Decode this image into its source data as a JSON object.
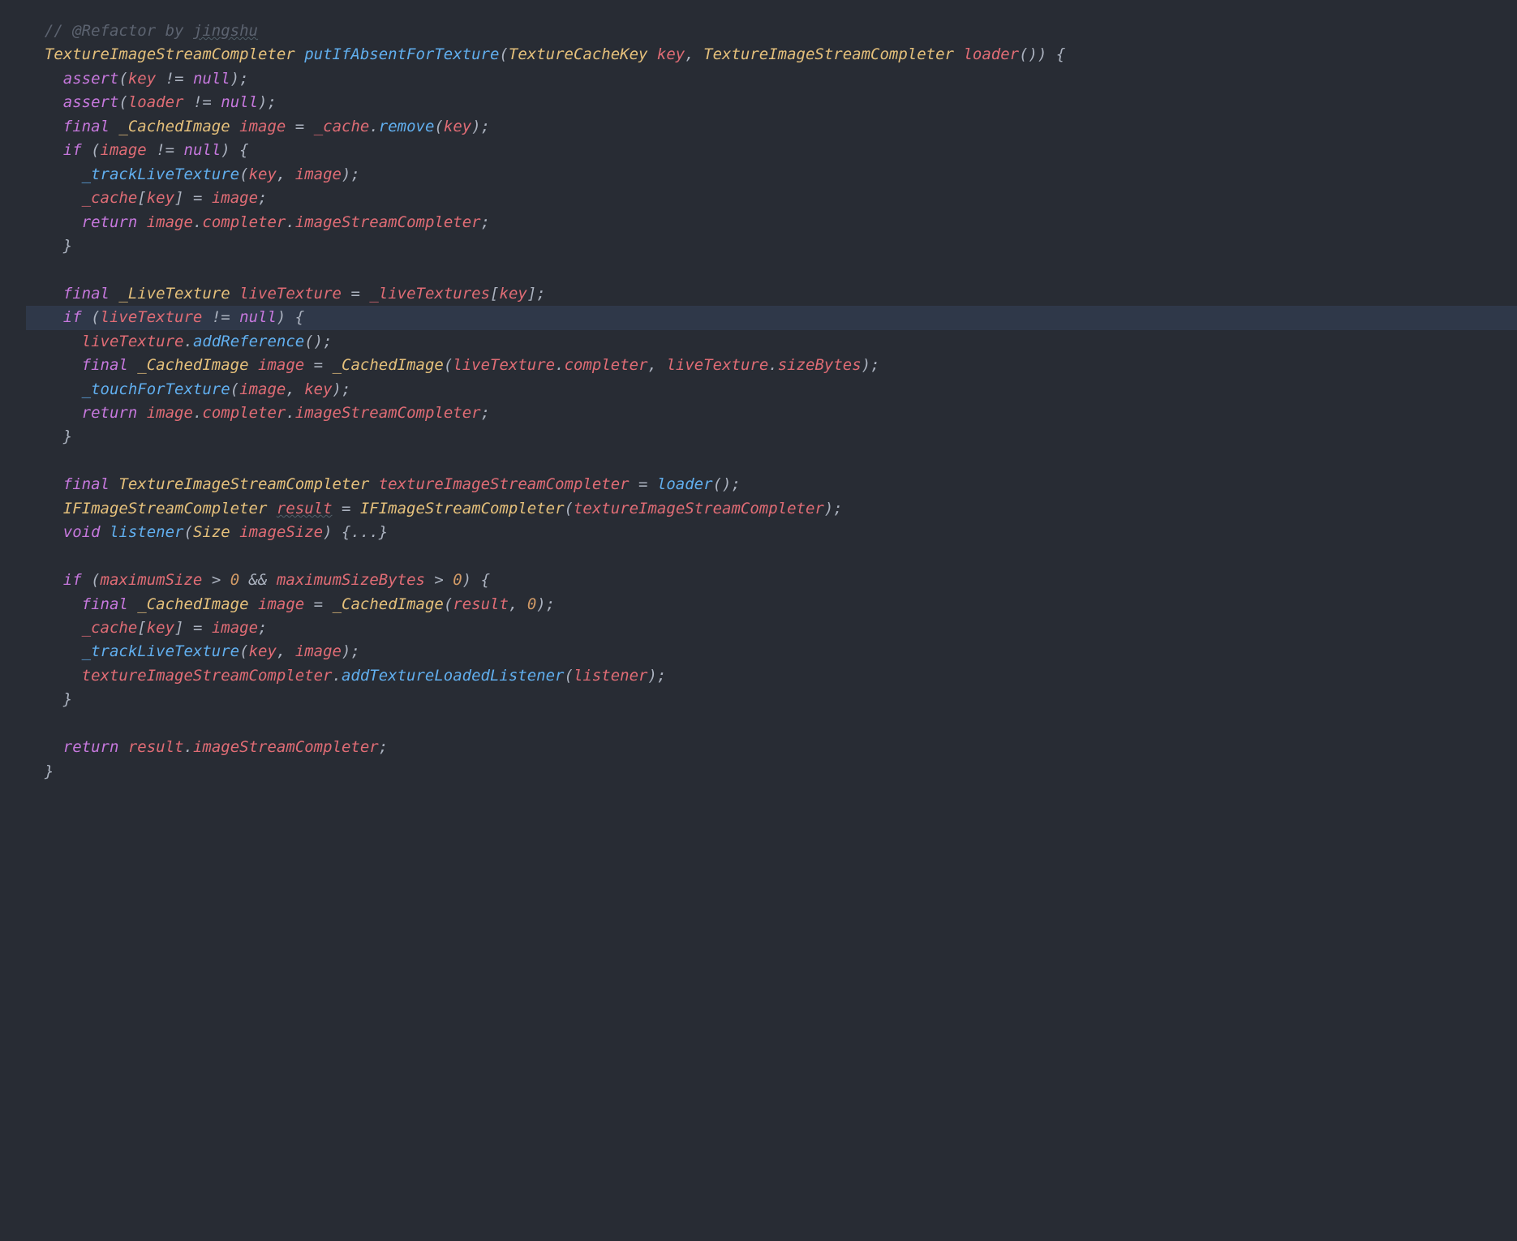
{
  "tokens": [
    [
      {
        "c": "  ",
        "cls": "plain"
      },
      {
        "c": "// @Refactor by ",
        "cls": "cmt"
      },
      {
        "c": "jingshu",
        "cls": "cmt under"
      }
    ],
    [
      {
        "c": "  ",
        "cls": "plain"
      },
      {
        "c": "TextureImageStreamCompleter",
        "cls": "type"
      },
      {
        "c": " ",
        "cls": "plain"
      },
      {
        "c": "putIfAbsentForTexture",
        "cls": "fn"
      },
      {
        "c": "(",
        "cls": "punc"
      },
      {
        "c": "TextureCacheKey",
        "cls": "type"
      },
      {
        "c": " key",
        "cls": "ident"
      },
      {
        "c": ", ",
        "cls": "punc"
      },
      {
        "c": "TextureImageStreamCompleter",
        "cls": "type"
      },
      {
        "c": " ",
        "cls": "plain"
      },
      {
        "c": "loader",
        "cls": "ident"
      },
      {
        "c": "()) {",
        "cls": "punc"
      }
    ],
    [
      {
        "c": "    ",
        "cls": "plain"
      },
      {
        "c": "assert",
        "cls": "kw"
      },
      {
        "c": "(",
        "cls": "punc"
      },
      {
        "c": "key",
        "cls": "ident"
      },
      {
        "c": " != ",
        "cls": "punc"
      },
      {
        "c": "null",
        "cls": "kw"
      },
      {
        "c": ");",
        "cls": "punc"
      }
    ],
    [
      {
        "c": "    ",
        "cls": "plain"
      },
      {
        "c": "assert",
        "cls": "kw"
      },
      {
        "c": "(",
        "cls": "punc"
      },
      {
        "c": "loader",
        "cls": "ident"
      },
      {
        "c": " != ",
        "cls": "punc"
      },
      {
        "c": "null",
        "cls": "kw"
      },
      {
        "c": ");",
        "cls": "punc"
      }
    ],
    [
      {
        "c": "    ",
        "cls": "plain"
      },
      {
        "c": "final",
        "cls": "kw"
      },
      {
        "c": " ",
        "cls": "plain"
      },
      {
        "c": "_CachedImage",
        "cls": "type"
      },
      {
        "c": " ",
        "cls": "plain"
      },
      {
        "c": "image",
        "cls": "ident"
      },
      {
        "c": " = ",
        "cls": "punc"
      },
      {
        "c": "_cache",
        "cls": "ident"
      },
      {
        "c": ".",
        "cls": "punc"
      },
      {
        "c": "remove",
        "cls": "fn"
      },
      {
        "c": "(",
        "cls": "punc"
      },
      {
        "c": "key",
        "cls": "ident"
      },
      {
        "c": ");",
        "cls": "punc"
      }
    ],
    [
      {
        "c": "    ",
        "cls": "plain"
      },
      {
        "c": "if",
        "cls": "kw"
      },
      {
        "c": " (",
        "cls": "punc"
      },
      {
        "c": "image",
        "cls": "ident"
      },
      {
        "c": " != ",
        "cls": "punc"
      },
      {
        "c": "null",
        "cls": "kw"
      },
      {
        "c": ") {",
        "cls": "punc"
      }
    ],
    [
      {
        "c": "      ",
        "cls": "plain"
      },
      {
        "c": "_trackLiveTexture",
        "cls": "fn"
      },
      {
        "c": "(",
        "cls": "punc"
      },
      {
        "c": "key",
        "cls": "ident"
      },
      {
        "c": ", ",
        "cls": "punc"
      },
      {
        "c": "image",
        "cls": "ident"
      },
      {
        "c": ");",
        "cls": "punc"
      }
    ],
    [
      {
        "c": "      ",
        "cls": "plain"
      },
      {
        "c": "_cache",
        "cls": "ident"
      },
      {
        "c": "[",
        "cls": "punc"
      },
      {
        "c": "key",
        "cls": "ident"
      },
      {
        "c": "] = ",
        "cls": "punc"
      },
      {
        "c": "image",
        "cls": "ident"
      },
      {
        "c": ";",
        "cls": "punc"
      }
    ],
    [
      {
        "c": "      ",
        "cls": "plain"
      },
      {
        "c": "return",
        "cls": "kw"
      },
      {
        "c": " ",
        "cls": "plain"
      },
      {
        "c": "image",
        "cls": "ident"
      },
      {
        "c": ".",
        "cls": "punc"
      },
      {
        "c": "completer",
        "cls": "ident"
      },
      {
        "c": ".",
        "cls": "punc"
      },
      {
        "c": "imageStreamCompleter",
        "cls": "ident"
      },
      {
        "c": ";",
        "cls": "punc"
      }
    ],
    [
      {
        "c": "    }",
        "cls": "punc"
      }
    ],
    [
      {
        "c": "",
        "cls": "plain"
      }
    ],
    [
      {
        "c": "    ",
        "cls": "plain"
      },
      {
        "c": "final",
        "cls": "kw"
      },
      {
        "c": " ",
        "cls": "plain"
      },
      {
        "c": "_LiveTexture",
        "cls": "type"
      },
      {
        "c": " ",
        "cls": "plain"
      },
      {
        "c": "liveTexture",
        "cls": "ident"
      },
      {
        "c": " = ",
        "cls": "punc"
      },
      {
        "c": "_liveTextures",
        "cls": "ident"
      },
      {
        "c": "[",
        "cls": "punc"
      },
      {
        "c": "key",
        "cls": "ident"
      },
      {
        "c": "];",
        "cls": "punc"
      }
    ],
    [
      {
        "c": "    ",
        "cls": "plain"
      },
      {
        "c": "if",
        "cls": "kw"
      },
      {
        "c": " (",
        "cls": "punc"
      },
      {
        "c": "liveTexture",
        "cls": "ident"
      },
      {
        "c": " != ",
        "cls": "punc"
      },
      {
        "c": "null",
        "cls": "kw"
      },
      {
        "c": ") {",
        "cls": "punc"
      }
    ],
    [
      {
        "c": "      ",
        "cls": "plain"
      },
      {
        "c": "liveTexture",
        "cls": "ident"
      },
      {
        "c": ".",
        "cls": "punc"
      },
      {
        "c": "addReference",
        "cls": "fn"
      },
      {
        "c": "();",
        "cls": "punc"
      }
    ],
    [
      {
        "c": "      ",
        "cls": "plain"
      },
      {
        "c": "final",
        "cls": "kw"
      },
      {
        "c": " ",
        "cls": "plain"
      },
      {
        "c": "_CachedImage",
        "cls": "type"
      },
      {
        "c": " ",
        "cls": "plain"
      },
      {
        "c": "image",
        "cls": "ident"
      },
      {
        "c": " = ",
        "cls": "punc"
      },
      {
        "c": "_CachedImage",
        "cls": "type"
      },
      {
        "c": "(",
        "cls": "punc"
      },
      {
        "c": "liveTexture",
        "cls": "ident"
      },
      {
        "c": ".",
        "cls": "punc"
      },
      {
        "c": "completer",
        "cls": "ident"
      },
      {
        "c": ", ",
        "cls": "punc"
      },
      {
        "c": "liveTexture",
        "cls": "ident"
      },
      {
        "c": ".",
        "cls": "punc"
      },
      {
        "c": "sizeBytes",
        "cls": "ident"
      },
      {
        "c": ");",
        "cls": "punc"
      }
    ],
    [
      {
        "c": "      ",
        "cls": "plain"
      },
      {
        "c": "_touchForTexture",
        "cls": "fn"
      },
      {
        "c": "(",
        "cls": "punc"
      },
      {
        "c": "image",
        "cls": "ident"
      },
      {
        "c": ", ",
        "cls": "punc"
      },
      {
        "c": "key",
        "cls": "ident"
      },
      {
        "c": ");",
        "cls": "punc"
      }
    ],
    [
      {
        "c": "      ",
        "cls": "plain"
      },
      {
        "c": "return",
        "cls": "kw"
      },
      {
        "c": " ",
        "cls": "plain"
      },
      {
        "c": "image",
        "cls": "ident"
      },
      {
        "c": ".",
        "cls": "punc"
      },
      {
        "c": "completer",
        "cls": "ident"
      },
      {
        "c": ".",
        "cls": "punc"
      },
      {
        "c": "imageStreamCompleter",
        "cls": "ident"
      },
      {
        "c": ";",
        "cls": "punc"
      }
    ],
    [
      {
        "c": "    }",
        "cls": "punc"
      }
    ],
    [
      {
        "c": "",
        "cls": "plain"
      }
    ],
    [
      {
        "c": "    ",
        "cls": "plain"
      },
      {
        "c": "final",
        "cls": "kw"
      },
      {
        "c": " ",
        "cls": "plain"
      },
      {
        "c": "TextureImageStreamCompleter",
        "cls": "type"
      },
      {
        "c": " ",
        "cls": "plain"
      },
      {
        "c": "textureImageStreamCompleter",
        "cls": "ident"
      },
      {
        "c": " = ",
        "cls": "punc"
      },
      {
        "c": "loader",
        "cls": "fn"
      },
      {
        "c": "();",
        "cls": "punc"
      }
    ],
    [
      {
        "c": "    ",
        "cls": "plain"
      },
      {
        "c": "IFImageStreamCompleter",
        "cls": "type"
      },
      {
        "c": " ",
        "cls": "plain"
      },
      {
        "c": "result",
        "cls": "ident under"
      },
      {
        "c": " = ",
        "cls": "punc"
      },
      {
        "c": "IFImageStreamCompleter",
        "cls": "type"
      },
      {
        "c": "(",
        "cls": "punc"
      },
      {
        "c": "textureImageStreamCompleter",
        "cls": "ident"
      },
      {
        "c": ");",
        "cls": "punc"
      }
    ],
    [
      {
        "c": "    ",
        "cls": "plain"
      },
      {
        "c": "void",
        "cls": "kw"
      },
      {
        "c": " ",
        "cls": "plain"
      },
      {
        "c": "listener",
        "cls": "fn"
      },
      {
        "c": "(",
        "cls": "punc"
      },
      {
        "c": "Size",
        "cls": "type"
      },
      {
        "c": " ",
        "cls": "plain"
      },
      {
        "c": "imageSize",
        "cls": "ident"
      },
      {
        "c": ") ",
        "cls": "punc"
      },
      {
        "c": "{...}",
        "cls": "fold"
      }
    ],
    [
      {
        "c": "",
        "cls": "plain"
      }
    ],
    [
      {
        "c": "    ",
        "cls": "plain"
      },
      {
        "c": "if",
        "cls": "kw"
      },
      {
        "c": " (",
        "cls": "punc"
      },
      {
        "c": "maximumSize",
        "cls": "ident"
      },
      {
        "c": " > ",
        "cls": "punc"
      },
      {
        "c": "0",
        "cls": "num"
      },
      {
        "c": " && ",
        "cls": "punc"
      },
      {
        "c": "maximumSizeBytes",
        "cls": "ident"
      },
      {
        "c": " > ",
        "cls": "punc"
      },
      {
        "c": "0",
        "cls": "num"
      },
      {
        "c": ") {",
        "cls": "punc"
      }
    ],
    [
      {
        "c": "      ",
        "cls": "plain"
      },
      {
        "c": "final",
        "cls": "kw"
      },
      {
        "c": " ",
        "cls": "plain"
      },
      {
        "c": "_CachedImage",
        "cls": "type"
      },
      {
        "c": " ",
        "cls": "plain"
      },
      {
        "c": "image",
        "cls": "ident"
      },
      {
        "c": " = ",
        "cls": "punc"
      },
      {
        "c": "_CachedImage",
        "cls": "type"
      },
      {
        "c": "(",
        "cls": "punc"
      },
      {
        "c": "result",
        "cls": "ident"
      },
      {
        "c": ", ",
        "cls": "punc"
      },
      {
        "c": "0",
        "cls": "num"
      },
      {
        "c": ");",
        "cls": "punc"
      }
    ],
    [
      {
        "c": "      ",
        "cls": "plain"
      },
      {
        "c": "_cache",
        "cls": "ident"
      },
      {
        "c": "[",
        "cls": "punc"
      },
      {
        "c": "key",
        "cls": "ident"
      },
      {
        "c": "] = ",
        "cls": "punc"
      },
      {
        "c": "image",
        "cls": "ident"
      },
      {
        "c": ";",
        "cls": "punc"
      }
    ],
    [
      {
        "c": "      ",
        "cls": "plain"
      },
      {
        "c": "_trackLiveTexture",
        "cls": "fn"
      },
      {
        "c": "(",
        "cls": "punc"
      },
      {
        "c": "key",
        "cls": "ident"
      },
      {
        "c": ", ",
        "cls": "punc"
      },
      {
        "c": "image",
        "cls": "ident"
      },
      {
        "c": ");",
        "cls": "punc"
      }
    ],
    [
      {
        "c": "      ",
        "cls": "plain"
      },
      {
        "c": "textureImageStreamCompleter",
        "cls": "ident"
      },
      {
        "c": ".",
        "cls": "punc"
      },
      {
        "c": "addTextureLoadedListener",
        "cls": "fn"
      },
      {
        "c": "(",
        "cls": "punc"
      },
      {
        "c": "listener",
        "cls": "ident"
      },
      {
        "c": ");",
        "cls": "punc"
      }
    ],
    [
      {
        "c": "    }",
        "cls": "punc"
      }
    ],
    [
      {
        "c": "",
        "cls": "plain"
      }
    ],
    [
      {
        "c": "    ",
        "cls": "plain"
      },
      {
        "c": "return",
        "cls": "kw"
      },
      {
        "c": " ",
        "cls": "plain"
      },
      {
        "c": "result",
        "cls": "ident"
      },
      {
        "c": ".",
        "cls": "punc"
      },
      {
        "c": "imageStreamCompleter",
        "cls": "ident"
      },
      {
        "c": ";",
        "cls": "punc"
      }
    ],
    [
      {
        "c": "  }",
        "cls": "punc"
      }
    ]
  ],
  "highlighted_line_index": 12
}
